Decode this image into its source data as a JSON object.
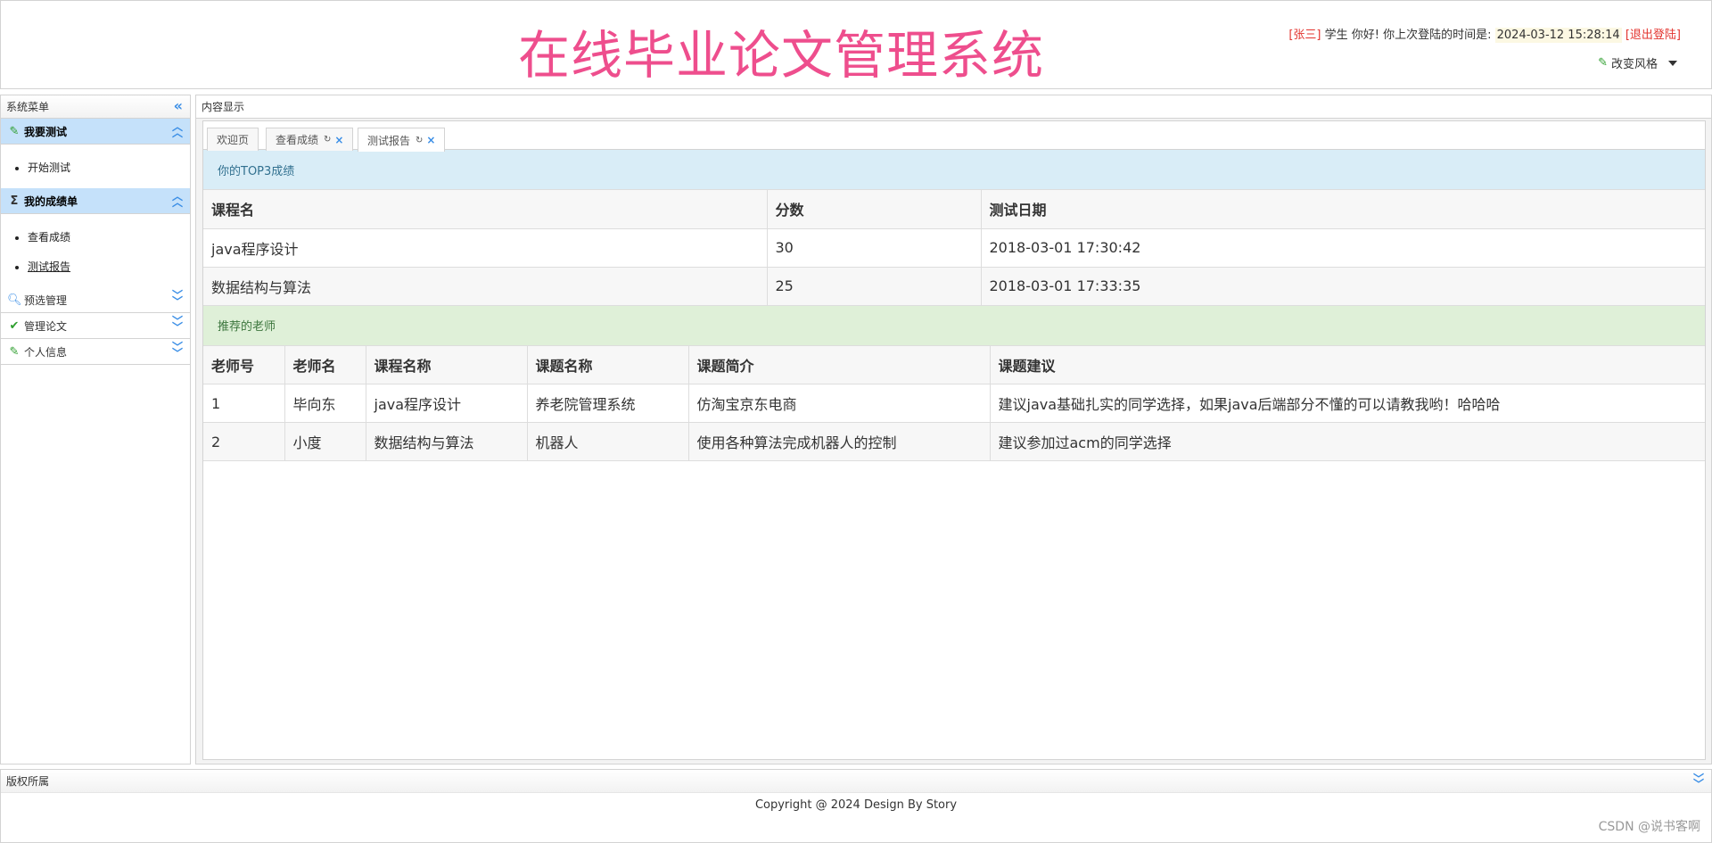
{
  "header": {
    "title": "在线毕业论文管理系统",
    "user_name": "[张三]",
    "greeting": "学生 你好! 你上次登陆的时间是:",
    "last_login": "2024-03-12 15:28:14",
    "logout_label": "[退出登陆]",
    "style_switch_label": "改变风格"
  },
  "sidebar": {
    "title": "系统菜单",
    "groups": [
      {
        "label": "我要测试",
        "icon": "pencil-icon",
        "open": true,
        "items": [
          {
            "label": "开始测试"
          }
        ]
      },
      {
        "label": "我的成绩单",
        "icon": "sigma-icon",
        "open": true,
        "items": [
          {
            "label": "查看成绩"
          },
          {
            "label": "测试报告",
            "active": true
          }
        ]
      },
      {
        "label": "预选管理",
        "icon": "search-icon",
        "open": false,
        "items": []
      },
      {
        "label": "管理论文",
        "icon": "check-icon",
        "open": false,
        "items": []
      },
      {
        "label": "个人信息",
        "icon": "pencil-icon",
        "open": false,
        "items": []
      }
    ]
  },
  "content": {
    "title": "内容显示",
    "tabs": [
      {
        "label": "欢迎页",
        "closable": false
      },
      {
        "label": "查看成绩",
        "closable": true
      },
      {
        "label": "测试报告",
        "closable": true,
        "active": true
      }
    ],
    "top3": {
      "heading": "你的TOP3成绩",
      "columns": [
        "课程名",
        "分数",
        "测试日期"
      ],
      "rows": [
        [
          "java程序设计",
          "30",
          "2018-03-01 17:30:42"
        ],
        [
          "数据结构与算法",
          "25",
          "2018-03-01 17:33:35"
        ]
      ]
    },
    "teachers": {
      "heading": "推荐的老师",
      "columns": [
        "老师号",
        "老师名",
        "课程名称",
        "课题名称",
        "课题简介",
        "课题建议"
      ],
      "rows": [
        [
          "1",
          "毕向东",
          "java程序设计",
          "养老院管理系统",
          "仿淘宝京东电商",
          "建议java基础扎实的同学选择，如果java后端部分不懂的可以请教我哟！哈哈哈"
        ],
        [
          "2",
          "小度",
          "数据结构与算法",
          "机器人",
          "使用各种算法完成机器人的控制",
          "建议参加过acm的同学选择"
        ]
      ]
    }
  },
  "footer": {
    "title": "版权所属",
    "copyright": "Copyright @ 2024 Design By Story",
    "watermark": "CSDN @说书客啊"
  },
  "colors": {
    "title_pink": "#ee4e8d",
    "accent_blue": "#3a8ee6",
    "menu_open_bg": "#c5e1fa",
    "info_bg": "#d9edf7",
    "success_bg": "#dff0d8"
  }
}
